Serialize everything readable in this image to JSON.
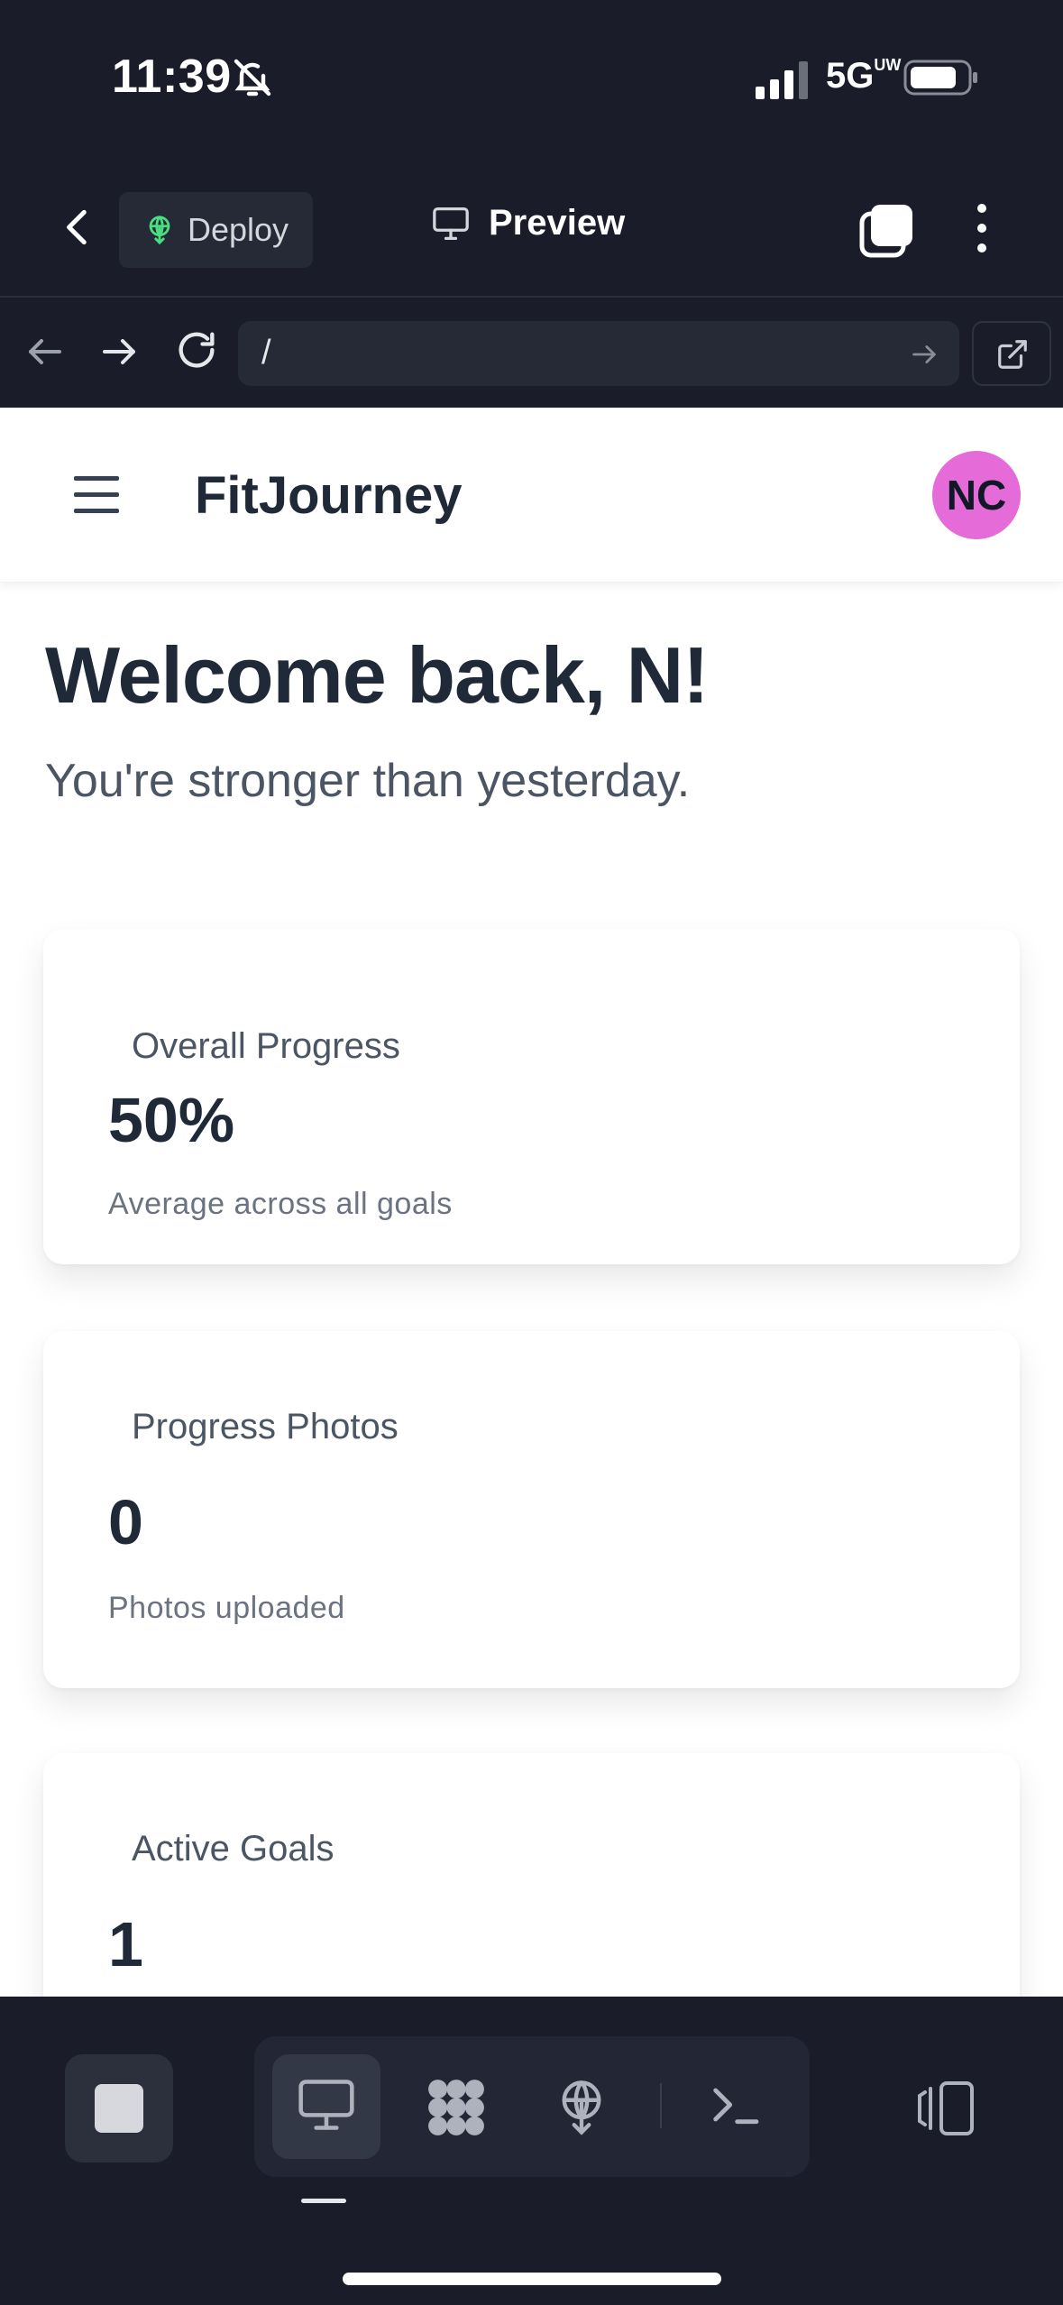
{
  "status_bar": {
    "time": "11:39",
    "network": "5G",
    "network_superscript": "UW"
  },
  "toolbar": {
    "deploy_label": "Deploy",
    "preview_label": "Preview"
  },
  "url_bar": {
    "url": "/"
  },
  "app": {
    "title": "FitJourney",
    "avatar_initials": "NC",
    "avatar_color": "#e46bd8",
    "welcome": "Welcome back, N!",
    "subtitle": "You're stronger than yesterday.",
    "cards": [
      {
        "title": "Overall Progress",
        "value": "50%",
        "description": "Average across all goals"
      },
      {
        "title": "Progress Photos",
        "value": "0",
        "description": "Photos uploaded"
      },
      {
        "title": "Active Goals",
        "value": "1",
        "description": ""
      }
    ]
  },
  "icons": {
    "bottom_bar": [
      "stop-icon",
      "desktop-icon",
      "apps-icon",
      "deploy-icon",
      "terminal-icon",
      "panel-icon"
    ]
  },
  "colors": {
    "chrome_bg": "#1a1d29",
    "deploy_green": "#4ade80"
  }
}
